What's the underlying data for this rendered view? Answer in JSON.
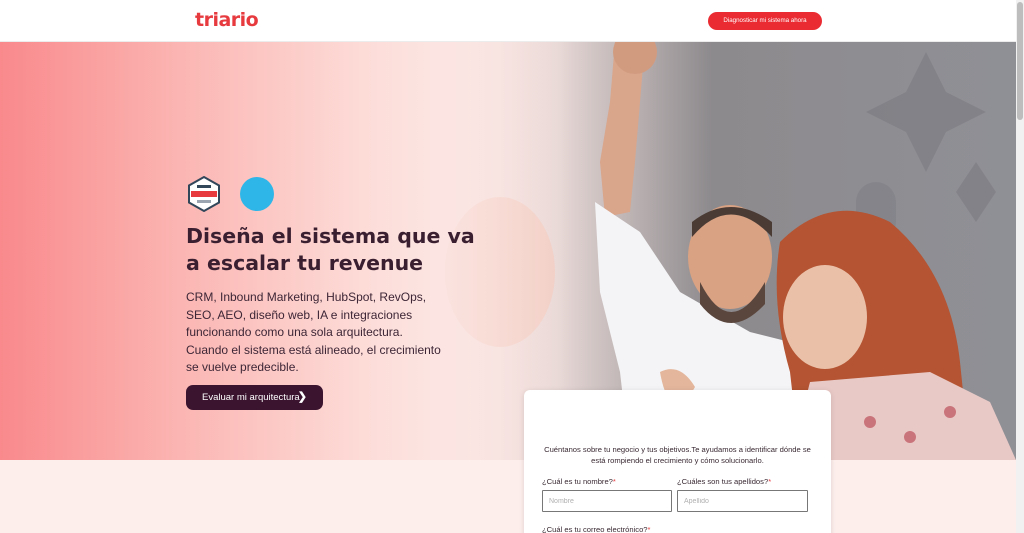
{
  "header": {
    "logo": "triario",
    "cta_label": "Diagnosticar mi sistema ahora"
  },
  "hero": {
    "badges": [
      "hubspot-partner-badge",
      "hubspot-select-badge"
    ],
    "title": "Diseña el sistema que va a escalar tu revenue",
    "description_lines": [
      "CRM, Inbound Marketing, HubSpot, RevOps, SEO, AEO, diseño web, IA e integraciones funcionando como una sola arquitectura.",
      "Cuando el sistema está alineado, el crecimiento se vuelve predecible."
    ],
    "button_label": "Evaluar mi arquitectura"
  },
  "form": {
    "intro": "Cuéntanos sobre tu negocio y tus objetivos.Te ayudamos a identificar dónde se está rompiendo el crecimiento y cómo solucionarlo.",
    "first_name_label": "¿Cuál es tu nombre?",
    "first_name_placeholder": "Nombre",
    "last_name_label": "¿Cuáles son tus apellidos?",
    "last_name_placeholder": "Apellido",
    "email_label": "¿Cuál es tu correo electrónico?",
    "required_mark": "*"
  },
  "colors": {
    "brand": "#e63a3f",
    "dark_button": "#3b1530"
  }
}
